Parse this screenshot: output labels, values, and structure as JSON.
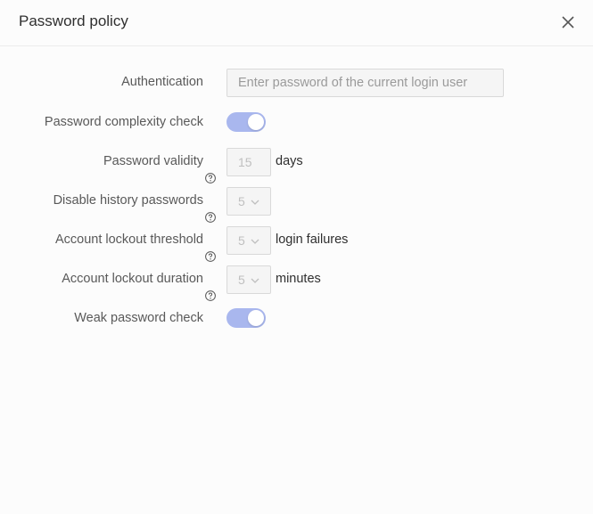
{
  "dialog": {
    "title": "Password policy",
    "close_icon": "close-icon"
  },
  "form": {
    "authentication": {
      "label": "Authentication",
      "placeholder": "Enter password of the current login user",
      "value": ""
    },
    "complexity_check": {
      "label": "Password complexity check",
      "enabled": true
    },
    "validity": {
      "label": "Password validity",
      "value": "15",
      "suffix": "days",
      "help_icon": "question-circle-icon"
    },
    "history": {
      "label": "Disable history passwords",
      "value": "5",
      "help_icon": "question-circle-icon"
    },
    "lockout_threshold": {
      "label": "Account lockout threshold",
      "value": "5",
      "suffix": "login failures",
      "help_icon": "question-circle-icon"
    },
    "lockout_duration": {
      "label": "Account lockout duration",
      "value": "5",
      "suffix": "minutes",
      "help_icon": "question-circle-icon"
    },
    "weak_check": {
      "label": "Weak password check",
      "enabled": true
    }
  },
  "colors": {
    "toggle_on": "#a9b7ee",
    "disabled_bg": "#f5f5f5",
    "border": "#d9d9d9"
  }
}
